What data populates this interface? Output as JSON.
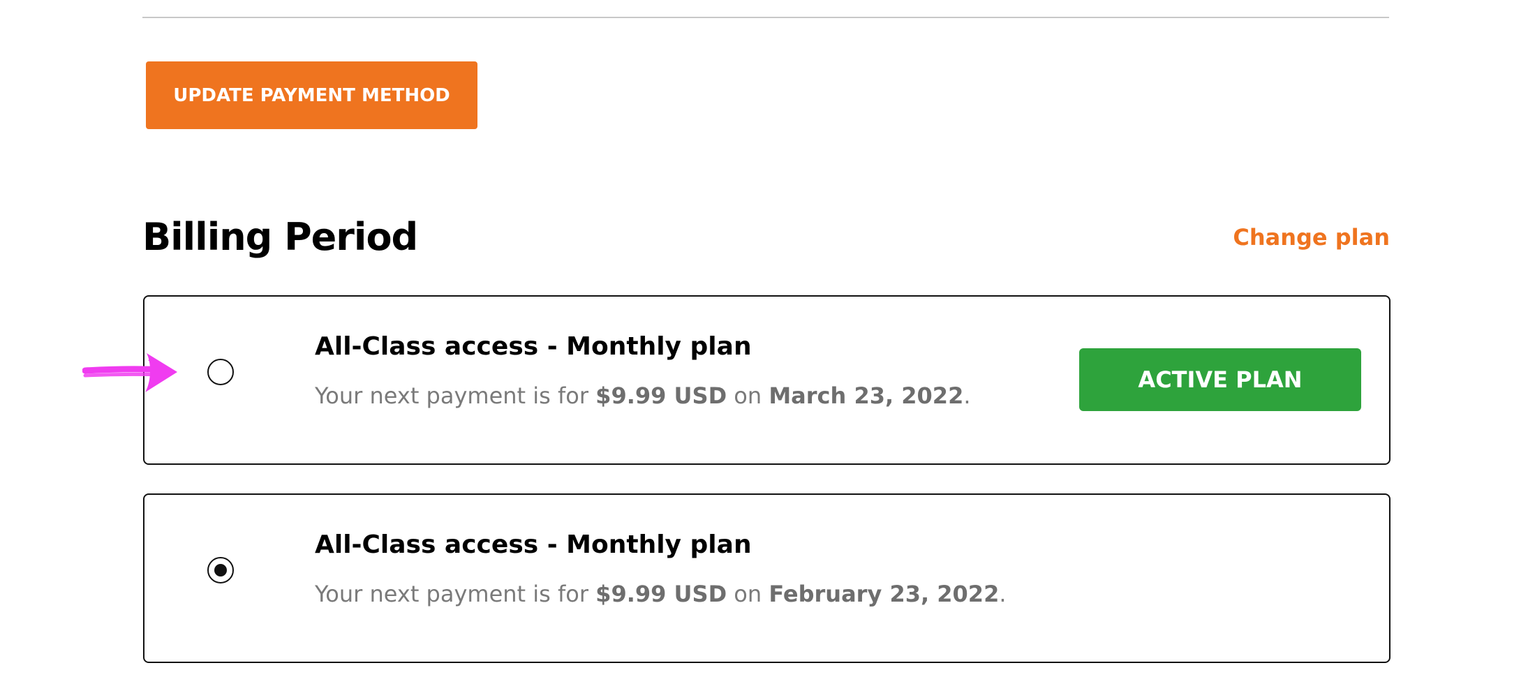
{
  "actions": {
    "update_payment_label": "UPDATE PAYMENT METHOD"
  },
  "billing": {
    "title": "Billing Period",
    "change_plan_label": "Change plan",
    "plans": [
      {
        "name": "All-Class access - Monthly plan",
        "detail_prefix": "Your next payment is for",
        "amount": "$9.99 USD",
        "detail_middle": "on",
        "date": "March 23, 2022",
        "detail_suffix": ".",
        "selected": false,
        "badge_label": "ACTIVE PLAN"
      },
      {
        "name": "All-Class access - Monthly plan",
        "detail_prefix": "Your next payment is for",
        "amount": "$9.99 USD",
        "detail_middle": "on",
        "date": "February 23, 2022",
        "detail_suffix": ".",
        "selected": true
      }
    ]
  },
  "colors": {
    "accent_orange": "#ef741f",
    "active_green": "#2ea33c",
    "annotation_magenta": "#f03cf0",
    "muted_text": "#7a7a7a"
  },
  "icons": {
    "annotation": "arrow-right-icon"
  }
}
